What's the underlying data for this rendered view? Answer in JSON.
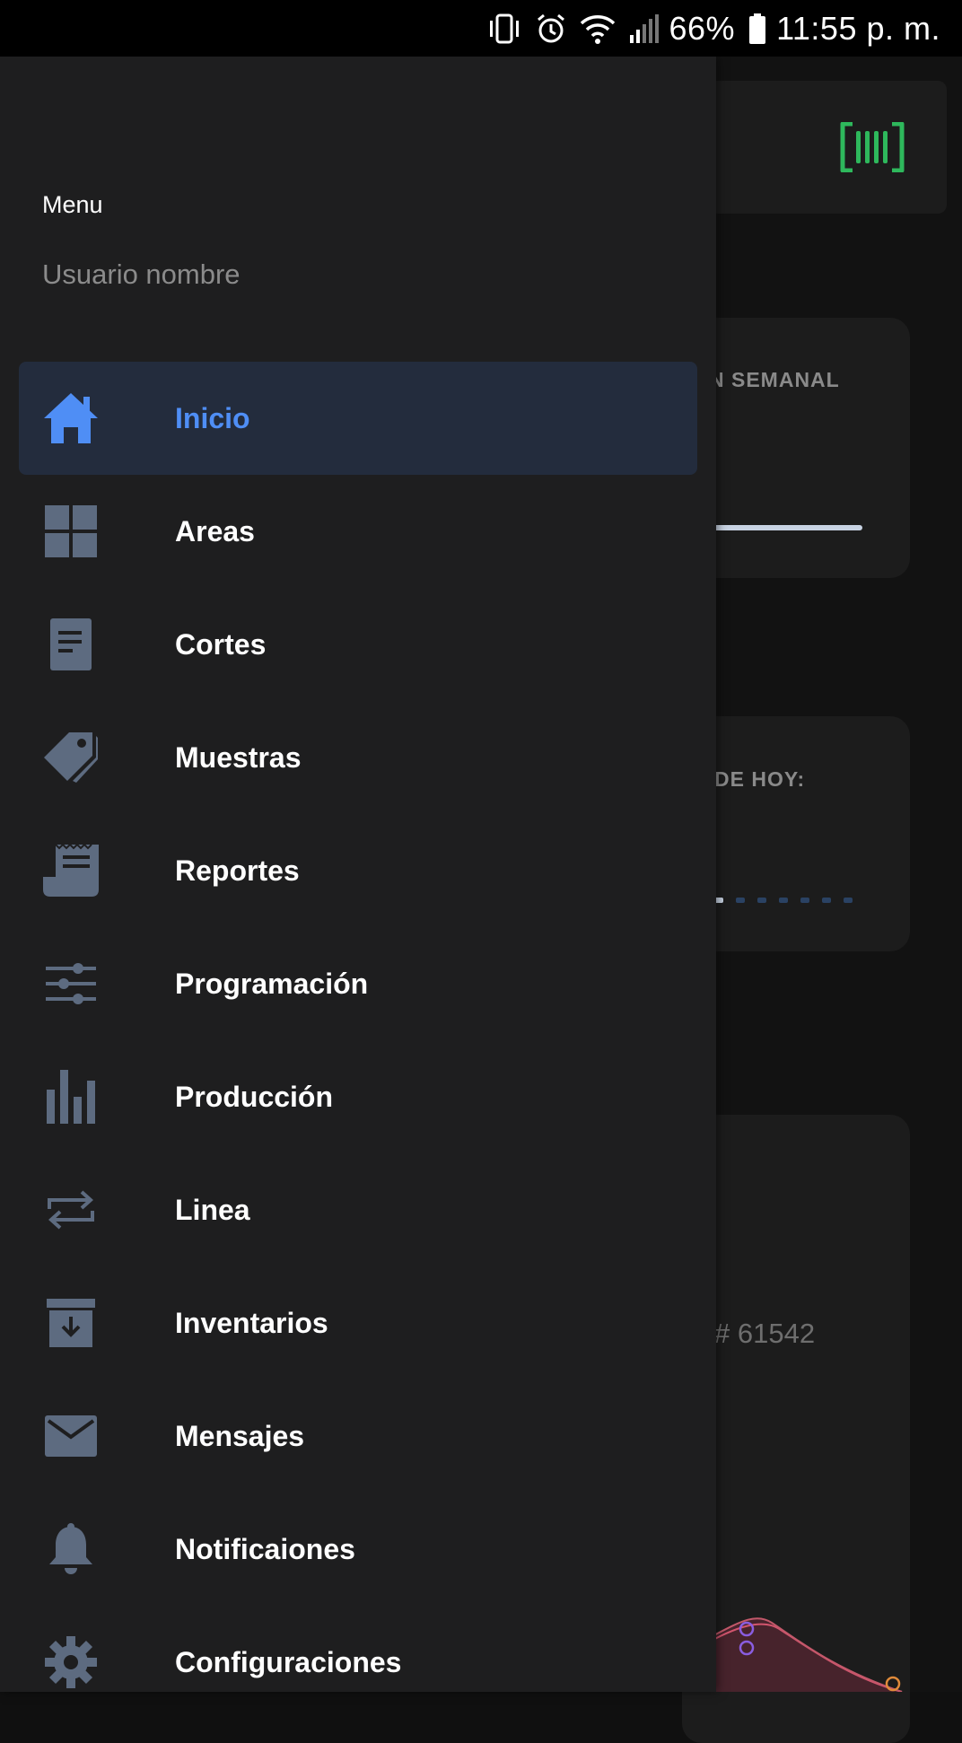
{
  "status_bar": {
    "battery": "66%",
    "time": "11:55 p. m.",
    "icons": [
      "vibrate-icon",
      "alarm-icon",
      "wifi-icon",
      "signal-icon",
      "battery-icon"
    ]
  },
  "background": {
    "card1_title": "N SEMANAL",
    "card2_title": "DE HOY:",
    "order_number": "# 61542",
    "scan_icon": "barcode-scanner-icon",
    "accent_green": "#2eb85c"
  },
  "drawer": {
    "title": "Menu",
    "user_name": "Usuario nombre",
    "items": [
      {
        "label": "Inicio",
        "icon": "home-icon",
        "active": true
      },
      {
        "label": "Areas",
        "icon": "grid-icon"
      },
      {
        "label": "Cortes",
        "icon": "document-icon"
      },
      {
        "label": "Muestras",
        "icon": "tag-icon"
      },
      {
        "label": "Reportes",
        "icon": "receipt-icon"
      },
      {
        "label": "Programación",
        "icon": "sliders-icon"
      },
      {
        "label": "Producción",
        "icon": "bar-chart-icon"
      },
      {
        "label": "Linea",
        "icon": "repeat-icon"
      },
      {
        "label": "Inventarios",
        "icon": "archive-icon"
      },
      {
        "label": "Mensajes",
        "icon": "mail-icon"
      },
      {
        "label": "Notificaiones",
        "icon": "bell-icon"
      },
      {
        "label": "Configuraciones",
        "icon": "gear-icon"
      }
    ],
    "active_color": "#4f8ef5",
    "icon_color": "#5d6b80"
  }
}
